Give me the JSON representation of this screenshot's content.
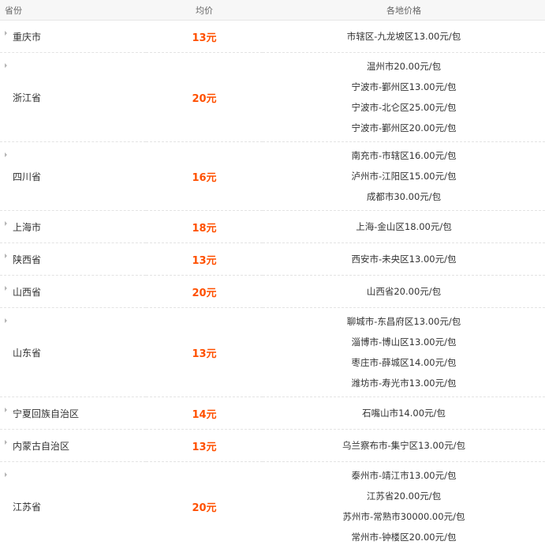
{
  "table": {
    "headers": {
      "province": "省份",
      "average": "均价",
      "regional": "各地价格"
    },
    "rows": [
      {
        "province": "重庆市",
        "average": "13元",
        "prices": [
          "市辖区-九龙坡区13.00元/包"
        ]
      },
      {
        "province": "浙江省",
        "average": "20元",
        "prices": [
          "温州市20.00元/包",
          "宁波市-鄞州区13.00元/包",
          "宁波市-北仑区25.00元/包",
          "宁波市-鄞州区20.00元/包"
        ]
      },
      {
        "province": "四川省",
        "average": "16元",
        "prices": [
          "南充市-市辖区16.00元/包",
          "泸州市-江阳区15.00元/包",
          "成都市30.00元/包"
        ]
      },
      {
        "province": "上海市",
        "average": "18元",
        "prices": [
          "上海-金山区18.00元/包"
        ]
      },
      {
        "province": "陕西省",
        "average": "13元",
        "prices": [
          "西安市-未央区13.00元/包"
        ]
      },
      {
        "province": "山西省",
        "average": "20元",
        "prices": [
          "山西省20.00元/包"
        ]
      },
      {
        "province": "山东省",
        "average": "13元",
        "prices": [
          "聊城市-东昌府区13.00元/包",
          "淄博市-博山区13.00元/包",
          "枣庄市-薛城区14.00元/包",
          "潍坊市-寿光市13.00元/包"
        ]
      },
      {
        "province": "宁夏回族自治区",
        "average": "14元",
        "prices": [
          "石嘴山市14.00元/包"
        ]
      },
      {
        "province": "内蒙古自治区",
        "average": "13元",
        "prices": [
          "乌兰察布市-集宁区13.00元/包"
        ]
      },
      {
        "province": "江苏省",
        "average": "20元",
        "prices": [
          "泰州市-靖江市13.00元/包",
          "江苏省20.00元/包",
          "苏州市-常熟市30000.00元/包",
          "常州市-钟楼区20.00元/包"
        ]
      }
    ]
  },
  "colors": {
    "accent_price": "#ff5000",
    "header_bg": "#f7f7f7",
    "text": "#333333"
  },
  "icons": {
    "row_expand": "triangle-right-icon"
  }
}
